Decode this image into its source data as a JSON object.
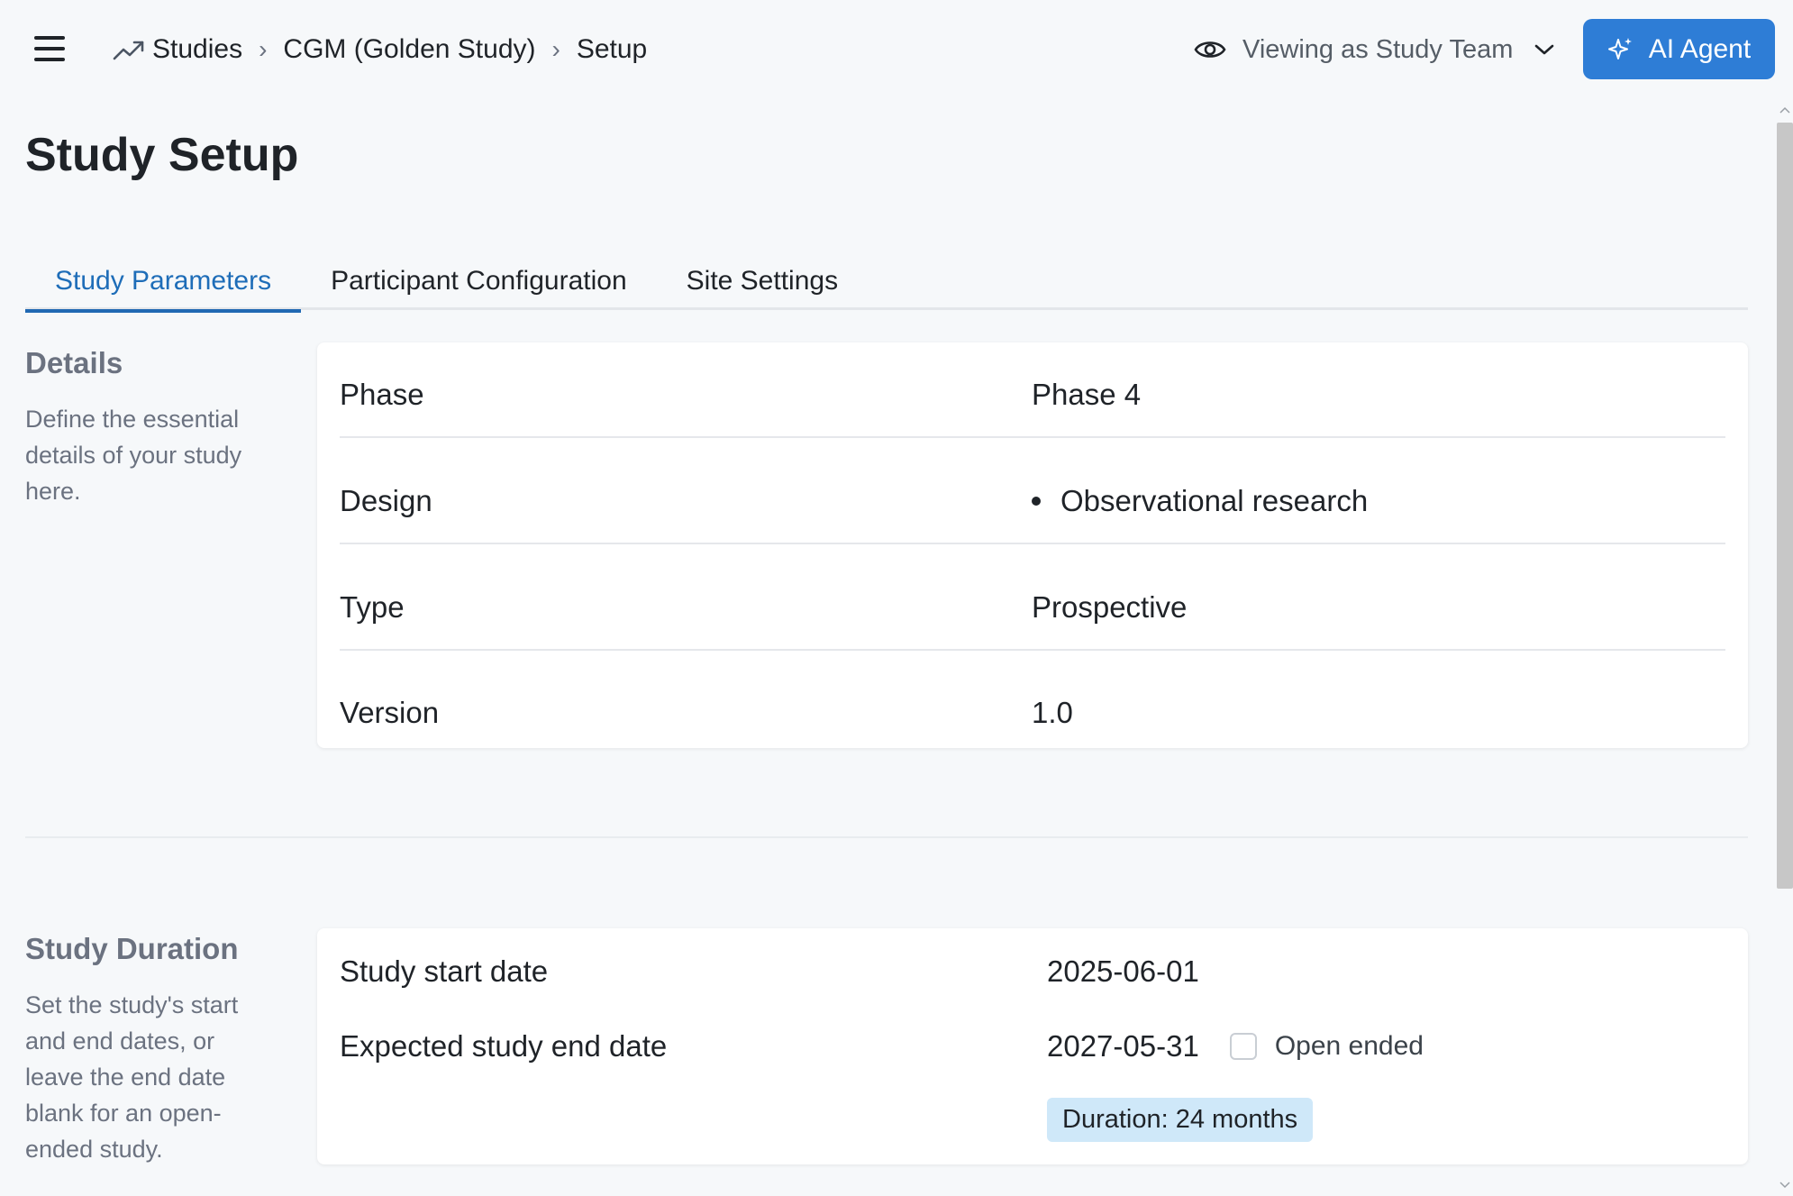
{
  "header": {
    "breadcrumb": [
      "Studies",
      "CGM (Golden Study)",
      "Setup"
    ],
    "view_as_label": "Viewing as Study Team",
    "ai_button_label": "AI Agent"
  },
  "page_title": "Study Setup",
  "tabs": [
    {
      "label": "Study Parameters",
      "active": true
    },
    {
      "label": "Participant Configuration",
      "active": false
    },
    {
      "label": "Site Settings",
      "active": false
    }
  ],
  "details": {
    "title": "Details",
    "description": "Define the essential details of your study here.",
    "rows": [
      {
        "label": "Phase",
        "value": "Phase 4"
      },
      {
        "label": "Design",
        "value": "Observational research"
      },
      {
        "label": "Type",
        "value": "Prospective"
      },
      {
        "label": "Version",
        "value": "1.0"
      }
    ]
  },
  "duration": {
    "title": "Study Duration",
    "description": "Set the study's start and end dates, or leave the end date blank for an open-ended study.",
    "start_label": "Study start date",
    "start_value": "2025-06-01",
    "end_label": "Expected study end date",
    "end_value": "2027-05-31",
    "open_ended_label": "Open ended",
    "open_ended_checked": false,
    "badge": "Duration: 24 months"
  },
  "colors": {
    "accent": "#2e7dd6",
    "active_tab": "#1e6db8",
    "badge_bg": "#cfe8f9"
  }
}
